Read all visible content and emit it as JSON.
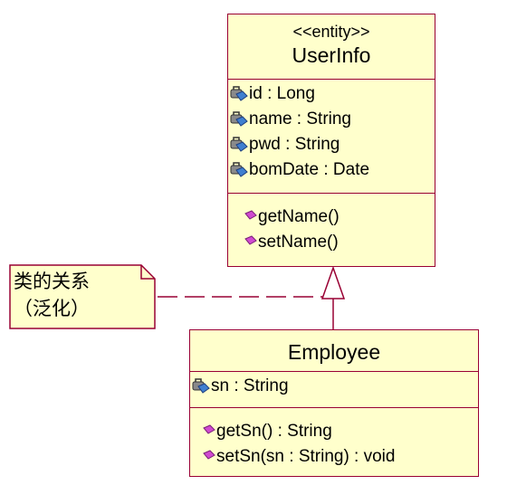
{
  "user_info": {
    "stereotype": "<<entity>>",
    "name": "UserInfo",
    "attributes": [
      "id : Long",
      "name : String",
      "pwd : String",
      "bomDate : Date"
    ],
    "operations": [
      "getName()",
      "setName()"
    ]
  },
  "employee": {
    "name": "Employee",
    "attributes": [
      "sn : String"
    ],
    "operations": [
      "getSn() : String",
      "setSn(sn : String) : void"
    ]
  },
  "note": {
    "line1": "类的关系",
    "line2": "（泛化）"
  },
  "colors": {
    "class_fill": "#ffffcc",
    "class_border": "#990033",
    "attribute_icon": "#4a6fa5",
    "operation_icon": "#cc44cc"
  }
}
